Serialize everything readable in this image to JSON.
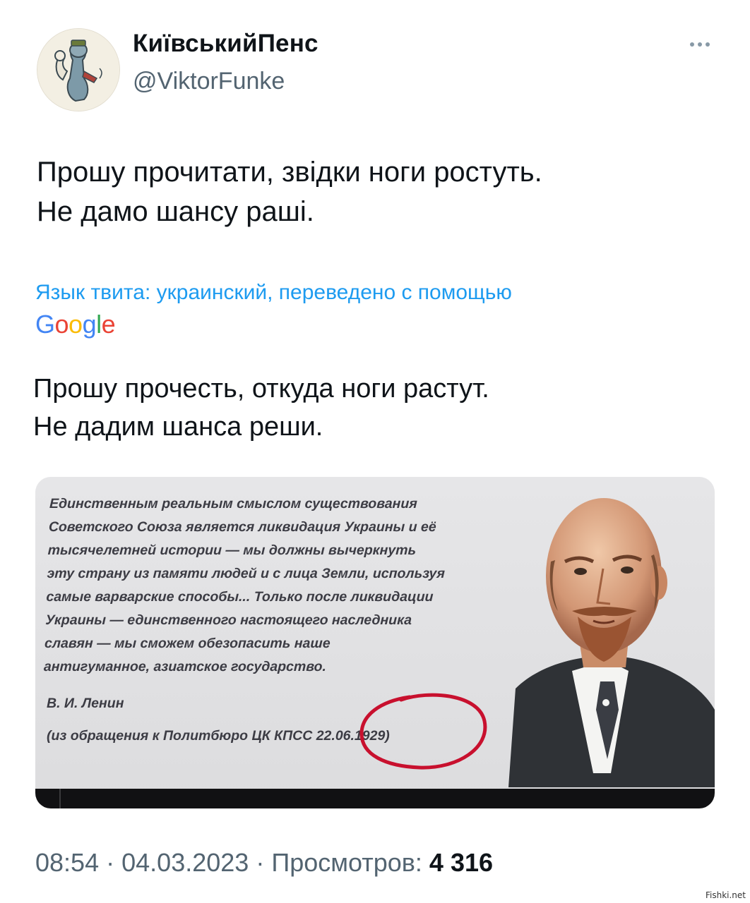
{
  "tweet": {
    "display_name": "КиївськийПенс",
    "handle": "@ViktorFunke",
    "more_icon": "more-horizontal-icon",
    "text_lines": [
      "Прошу прочитати, звідки ноги ростуть.",
      "Не дамо шансу раші."
    ],
    "translation_note": "Язык твита: украинский, переведено с помощью",
    "google_logo": "Google",
    "translated_lines": [
      "Прошу прочесть, откуда ноги растут.",
      "Не дадим шанса реши."
    ],
    "media": {
      "quote_lines": [
        "Единственным реальным смыслом существования",
        "Советского Союза является ликвидация Украины и её",
        "тысячелетней истории — мы должны вычеркнуть",
        "эту страну из памяти людей и с лица Земли, используя",
        "самые варварские способы... Только после ликвидации",
        "Украины — единственного настоящего наследника",
        "славян — мы сможем обезопасить наше",
        "антигуманное, азиатское государство."
      ],
      "author": "В. И. Ленин",
      "source": "(из обращения к Политбюро ЦК КПСС 22.06.1929)"
    },
    "time": "08:54",
    "date": "04.03.2023",
    "views_label": "Просмотров:",
    "views_count": "4 316",
    "separator": "·"
  },
  "watermark": "Fishki.net",
  "colors": {
    "link": "#1d9bf0",
    "secondary_text": "#536471",
    "primary_text": "#0f1419",
    "annotation_circle": "#c8102e"
  }
}
